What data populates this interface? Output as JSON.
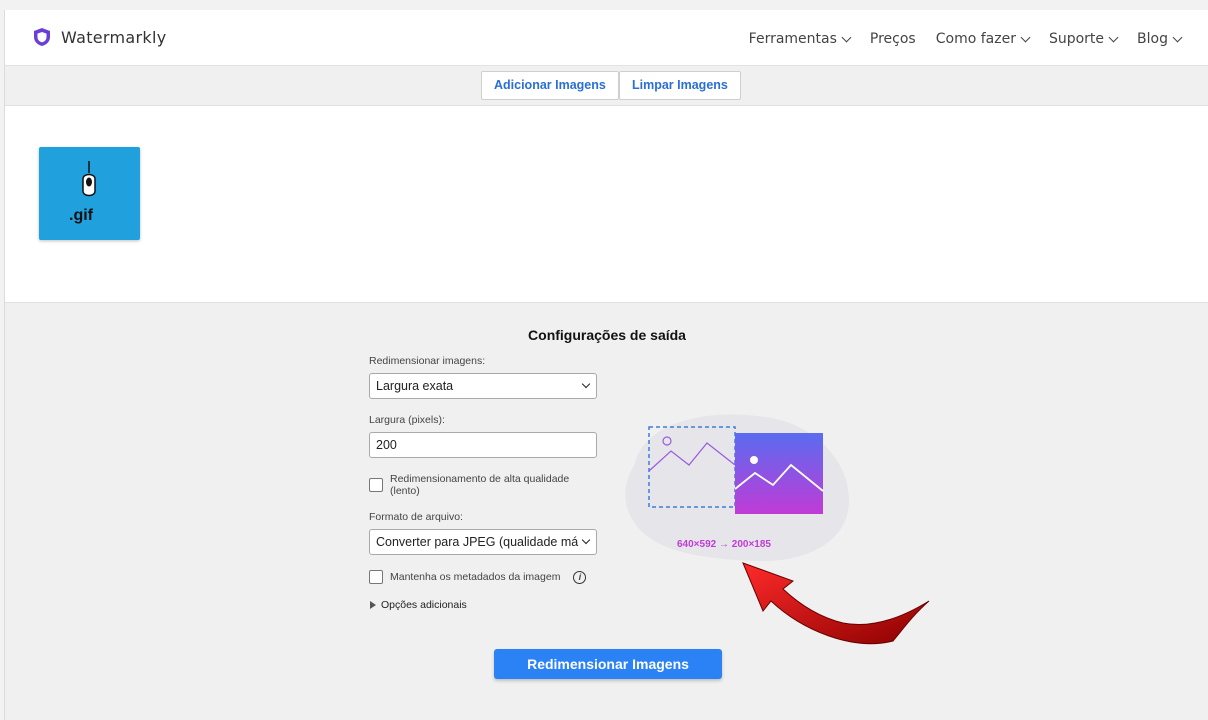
{
  "header": {
    "brand": "Watermarkly",
    "nav": [
      {
        "label": "Ferramentas",
        "dropdown": true
      },
      {
        "label": "Preços",
        "dropdown": false
      },
      {
        "label": "Como fazer",
        "dropdown": true
      },
      {
        "label": "Suporte",
        "dropdown": true
      },
      {
        "label": "Blog",
        "dropdown": true
      }
    ]
  },
  "toolbar": {
    "add_label": "Adicionar Imagens",
    "clear_label": "Limpar Imagens"
  },
  "gallery": {
    "items": [
      {
        "label": ".gif",
        "icon": "mouse-icon"
      }
    ]
  },
  "settings": {
    "title": "Configurações de saída",
    "resize_label": "Redimensionar imagens:",
    "resize_value": "Largura exata",
    "width_label": "Largura (pixels):",
    "width_value": "200",
    "hq_label": "Redimensionamento de alta qualidade (lento)",
    "hq_checked": false,
    "format_label": "Formato de arquivo:",
    "format_value": "Converter para JPEG (qualidade má",
    "metadata_label": "Mantenha os metadados da imagem",
    "metadata_checked": false,
    "more_label": "Opções adicionais",
    "submit_label": "Redimensionar Imagens",
    "dims_text": "640×592 → 200×185"
  },
  "colors": {
    "accent": "#2b82f5",
    "link": "#2a6fd6",
    "dims": "#c03bd6",
    "arrow": "#c00000"
  }
}
